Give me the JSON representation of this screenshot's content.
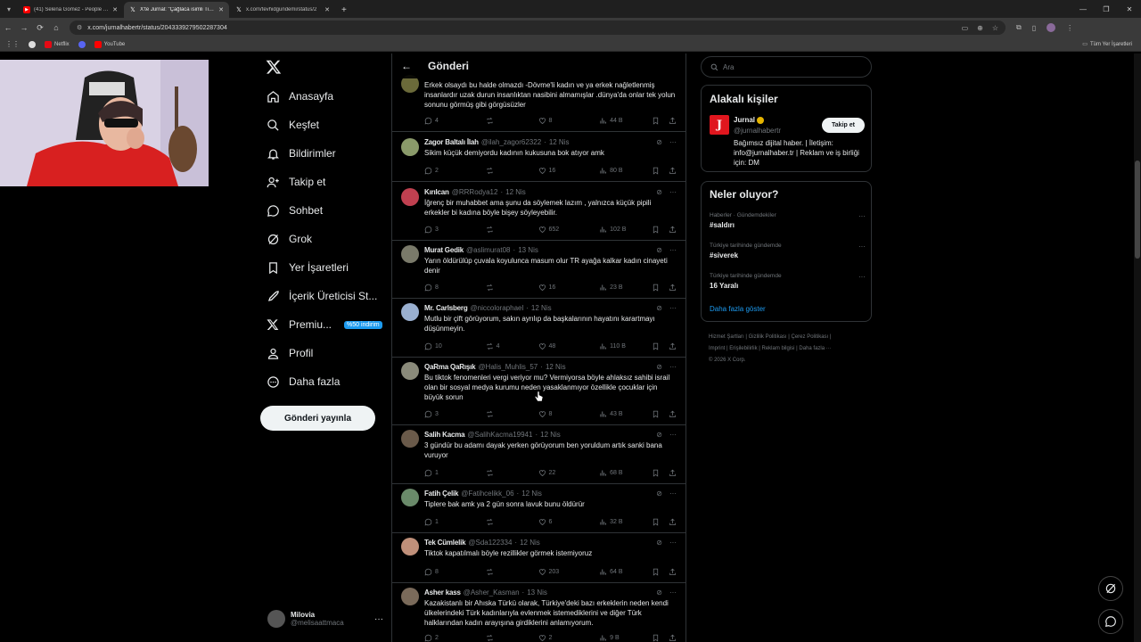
{
  "browser": {
    "tabs": [
      {
        "title": "(41) Selena Gomez - People You",
        "fav_color": "#ff0000",
        "fav_glyph": "▶",
        "active": false
      },
      {
        "title": "X'te Jurnal: \"Çağlaca isimli TikTok",
        "fav_color": "#ffffff",
        "fav_glyph": "𝕏",
        "active": true
      },
      {
        "title": "x.com/tevhidgundemi/status/2",
        "fav_color": "#ffffff",
        "fav_glyph": "𝕏",
        "active": false
      }
    ],
    "url": "x.com/jurnalhabertr/status/2043339279502287304",
    "bookmarks": [
      {
        "label": "Netflix",
        "color": "#e50914"
      },
      {
        "label": "YouTube",
        "color": "#ff0000"
      }
    ],
    "all_bookmarks": "Tüm Yer İşaretleri"
  },
  "nav": {
    "items": [
      {
        "label": "Anasayfa",
        "icon": "home-icon",
        "bold": true
      },
      {
        "label": "Keşfet",
        "icon": "search-icon"
      },
      {
        "label": "Bildirimler",
        "icon": "bell-icon"
      },
      {
        "label": "Takip et",
        "icon": "follow-icon"
      },
      {
        "label": "Sohbet",
        "icon": "chat-icon"
      },
      {
        "label": "Grok",
        "icon": "grok-icon"
      },
      {
        "label": "Yer İşaretleri",
        "icon": "bookmark-icon"
      },
      {
        "label": "İçerik Üreticisi St...",
        "icon": "rocket-icon"
      },
      {
        "label": "Premiu...",
        "icon": "x-icon",
        "badge": "%50 indirim"
      },
      {
        "label": "Profil",
        "icon": "profile-icon"
      },
      {
        "label": "Daha fazla",
        "icon": "more-icon"
      }
    ],
    "post_button": "Gönderi yayınla",
    "account": {
      "name": "Milovia",
      "handle": "@melisaattmaca"
    }
  },
  "center": {
    "title": "Gönderi",
    "replies": [
      {
        "name": "",
        "handle": "",
        "time": "",
        "text": "Erkek olsaydı bu halde olmazdı -Dövme'li kadın ve ya  erkek nağletlenmiş insanlardır uzak durun insanlıktan nasibini almamışlar .dünya'da onlar tek yolun sonunu görmüş gibi görgüsüzler",
        "replies": "4",
        "reposts": "",
        "likes": "8",
        "views": "44 B",
        "av_color": "#6b6a3a"
      },
      {
        "name": "Zagor Baltalı İlah",
        "handle": "@ilah_zagor62322",
        "time": "12 Nis",
        "text": "Sikim küçük demiyordu kadının kukusuna bok atıyor amk",
        "replies": "2",
        "reposts": "",
        "likes": "16",
        "views": "80 B",
        "av_color": "#8a9a6a"
      },
      {
        "name": "Kırılcan",
        "handle": "@RRRodya12",
        "time": "12 Nis",
        "text": "İğrenç bir muhabbet ama şunu da söylemek lazım , yalnızca küçük pipili erkekler bi kadına böyle bişey söyleyebilir.",
        "replies": "3",
        "reposts": "",
        "likes": "652",
        "views": "102 B",
        "av_color": "#c04050"
      },
      {
        "name": "Murat Gedik",
        "handle": "@aslimurat08",
        "time": "13 Nis",
        "text": "Yarın öldürülüp çuvala koyulunca masum olur TR ayağa kalkar kadın cinayeti denir",
        "replies": "8",
        "reposts": "",
        "likes": "16",
        "views": "23 B",
        "av_color": "#7a7a6a"
      },
      {
        "name": "Mr. Carlsberg",
        "handle": "@niccoloraphael",
        "time": "12 Nis",
        "text": "Mutlu bir çift görüyorum, sakın ayrılıp da başkalarının hayatını karartmayı düşünmeyin.",
        "replies": "10",
        "reposts": "4",
        "likes": "48",
        "views": "110 B",
        "av_color": "#9ab0d0"
      },
      {
        "name": "QaRma QaRışık",
        "handle": "@Halis_Muhlis_57",
        "time": "12 Nis",
        "text": "Bu tiktok fenomenleri vergi veriyor mu? Vermiyorsa böyle ahlaksız sahibi israil olan bir sosyal medya kurumu neden yasaklanmıyor özellikle çocuklar için büyük sorun",
        "replies": "3",
        "reposts": "",
        "likes": "8",
        "views": "43 B",
        "av_color": "#8a8a7a"
      },
      {
        "name": "Salih Kacma",
        "handle": "@SalihKacma19941",
        "time": "12 Nis",
        "text": "3 gündür bu adamı dayak yerken görüyorum ben yoruldum artık sanki bana vuruyor",
        "replies": "1",
        "reposts": "",
        "likes": "22",
        "views": "68 B",
        "av_color": "#6a5a4a"
      },
      {
        "name": "Fatih Çelik",
        "handle": "@Fatihcelikk_06",
        "time": "12 Nis",
        "text": "Tiplere bak amk ya 2 gün sonra lavuk bunu öldürür",
        "replies": "1",
        "reposts": "",
        "likes": "6",
        "views": "32 B",
        "av_color": "#6a8a6a"
      },
      {
        "name": "Tek Cümlelik",
        "handle": "@Sda122334",
        "time": "12 Nis",
        "text": "Tiktok kapatılmalı böyle rezillikler görmek istemiyoruz",
        "replies": "8",
        "reposts": "",
        "likes": "203",
        "views": "64 B",
        "av_color": "#c0907a"
      },
      {
        "name": "Asher kass",
        "handle": "@Asher_Kasman",
        "time": "13 Nis",
        "text": "Kazakistanlı bir Ahıska Türkü olarak, Türkiye'deki bazı erkeklerin neden kendi ülkelerindeki Türk kadınlarıyla evlenmek istemediklerini ve diğer Türk halklarından kadın arayışına girdiklerini anlamıyorum.",
        "replies": "2",
        "reposts": "",
        "likes": "2",
        "views": "9 B",
        "av_color": "#7a6a5a"
      }
    ]
  },
  "right": {
    "search_placeholder": "Ara",
    "relevant_title": "Alakalı kişiler",
    "relevant": {
      "name": "Jurnal",
      "handle": "@jurnalhabertr",
      "follow": "Takip et",
      "bio": "Bağımsız dijital haber. | İletişim: info@jurnalhaber.tr | Reklam ve iş birliği için: DM",
      "logo": "J"
    },
    "trends_title": "Neler oluyor?",
    "trends": [
      {
        "context": "Haberler · Gündemdekiler",
        "name": "#saldırı"
      },
      {
        "context": "Türkiye tarihinde gündemde",
        "name": "#siverek"
      },
      {
        "context": "Türkiye tarihinde gündemde",
        "name": "16 Yaralı"
      }
    ],
    "show_more": "Daha fazla göster",
    "footer": [
      "Hizmet Şartları",
      "Gizlilik Politikası",
      "Çerez Politikası",
      "Imprint",
      "Erişilebilirlik",
      "Reklam bilgisi",
      "Daha fazla ···",
      "© 2026 X Corp."
    ]
  }
}
